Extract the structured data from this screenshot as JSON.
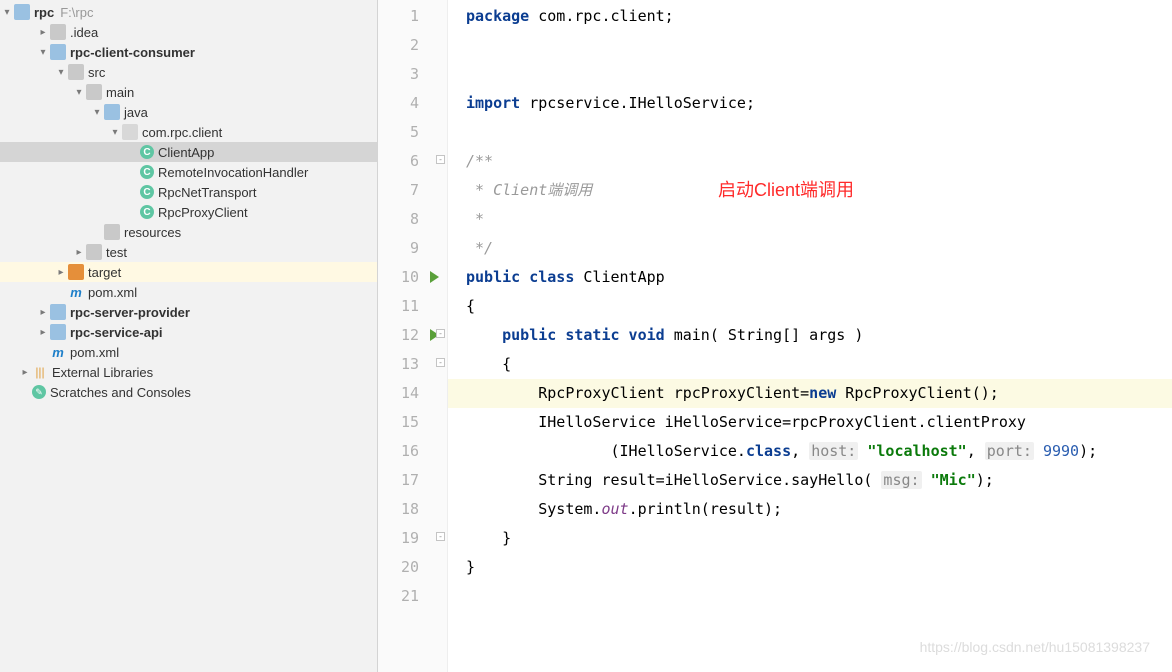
{
  "project": {
    "root_name": "rpc",
    "root_path": "F:\\rpc",
    "nodes": [
      {
        "id": "idea",
        "label": ".idea",
        "depth": 1,
        "icon": "folder",
        "arrow": "right"
      },
      {
        "id": "client-consumer",
        "label": "rpc-client-consumer",
        "depth": 1,
        "icon": "folder-blue",
        "arrow": "down",
        "bold": true
      },
      {
        "id": "src",
        "label": "src",
        "depth": 2,
        "icon": "folder",
        "arrow": "down"
      },
      {
        "id": "main",
        "label": "main",
        "depth": 3,
        "icon": "folder",
        "arrow": "down"
      },
      {
        "id": "java",
        "label": "java",
        "depth": 4,
        "icon": "folder-blue",
        "arrow": "down"
      },
      {
        "id": "pkg",
        "label": "com.rpc.client",
        "depth": 5,
        "icon": "pkg",
        "arrow": "down"
      },
      {
        "id": "clientapp",
        "label": "ClientApp",
        "depth": 6,
        "icon": "class",
        "selected": true
      },
      {
        "id": "remoteinv",
        "label": "RemoteInvocationHandler",
        "depth": 6,
        "icon": "class"
      },
      {
        "id": "rpcnet",
        "label": "RpcNetTransport",
        "depth": 6,
        "icon": "class"
      },
      {
        "id": "rpcproxy",
        "label": "RpcProxyClient",
        "depth": 6,
        "icon": "class"
      },
      {
        "id": "resources",
        "label": "resources",
        "depth": 4,
        "icon": "folder"
      },
      {
        "id": "test",
        "label": "test",
        "depth": 3,
        "icon": "folder",
        "arrow": "right"
      },
      {
        "id": "target",
        "label": "target",
        "depth": 2,
        "icon": "folder-orange",
        "arrow": "right",
        "hl": true
      },
      {
        "id": "pom1",
        "label": "pom.xml",
        "depth": 2,
        "icon": "maven"
      },
      {
        "id": "server-provider",
        "label": "rpc-server-provider",
        "depth": 1,
        "icon": "folder-blue",
        "arrow": "right",
        "bold": true
      },
      {
        "id": "service-api",
        "label": "rpc-service-api",
        "depth": 1,
        "icon": "folder-blue",
        "arrow": "right",
        "bold": true
      },
      {
        "id": "pom2",
        "label": "pom.xml",
        "depth": 1,
        "icon": "maven"
      },
      {
        "id": "extlib",
        "label": "External Libraries",
        "depth": 0,
        "icon": "lib",
        "arrow": "right"
      },
      {
        "id": "scratch",
        "label": "Scratches and Consoles",
        "depth": 0,
        "icon": "scratch"
      }
    ]
  },
  "editor": {
    "annotation": "启动Client端调用",
    "watermark": "https://blog.csdn.net/hu15081398237",
    "highlighted_line": 14,
    "runnable_lines": [
      10,
      12
    ],
    "fold_lines": [
      6,
      12,
      13,
      19
    ],
    "code": {
      "l1": {
        "tokens": [
          {
            "t": "package",
            "c": "kw"
          },
          {
            "t": " com.rpc.client;"
          }
        ]
      },
      "l4": {
        "tokens": [
          {
            "t": "import",
            "c": "kw"
          },
          {
            "t": " rpcservice.IHelloService;"
          }
        ]
      },
      "l6": {
        "tokens": [
          {
            "t": "/**",
            "c": "com"
          }
        ]
      },
      "l7": {
        "tokens": [
          {
            "t": " * Client端调用",
            "c": "com"
          }
        ]
      },
      "l8": {
        "tokens": [
          {
            "t": " *",
            "c": "com"
          }
        ]
      },
      "l9": {
        "tokens": [
          {
            "t": " */",
            "c": "com"
          }
        ]
      },
      "l10": {
        "tokens": [
          {
            "t": "public class",
            "c": "kw"
          },
          {
            "t": " ClientApp"
          }
        ]
      },
      "l11": {
        "tokens": [
          {
            "t": "{"
          }
        ]
      },
      "l12": {
        "tokens": [
          {
            "t": "    "
          },
          {
            "t": "public static void",
            "c": "kw"
          },
          {
            "t": " main( String[] args )"
          }
        ]
      },
      "l13": {
        "tokens": [
          {
            "t": "    {"
          }
        ]
      },
      "l14": {
        "tokens": [
          {
            "t": "        RpcProxyClient rpcProxyClient="
          },
          {
            "t": "new",
            "c": "kw"
          },
          {
            "t": " RpcProxyClient();"
          }
        ]
      },
      "l15": {
        "tokens": [
          {
            "t": "        IHelloService iHelloService=rpcProxyClient.clientProxy"
          }
        ]
      },
      "l16": {
        "tokens": [
          {
            "t": "                (IHelloService."
          },
          {
            "t": "class",
            "c": "kw"
          },
          {
            "t": ", "
          },
          {
            "t": "host:",
            "c": "hint"
          },
          {
            "t": " "
          },
          {
            "t": "\"localhost\"",
            "c": "str"
          },
          {
            "t": ", "
          },
          {
            "t": "port:",
            "c": "hint"
          },
          {
            "t": " "
          },
          {
            "t": "9990",
            "c": "num"
          },
          {
            "t": ");"
          }
        ]
      },
      "l17": {
        "tokens": [
          {
            "t": "        String result=iHelloService.sayHello( "
          },
          {
            "t": "msg:",
            "c": "hint"
          },
          {
            "t": " "
          },
          {
            "t": "\"Mic\"",
            "c": "str"
          },
          {
            "t": ");"
          }
        ]
      },
      "l18": {
        "tokens": [
          {
            "t": "        System."
          },
          {
            "t": "out",
            "c": "field"
          },
          {
            "t": ".println(result);"
          }
        ]
      },
      "l19": {
        "tokens": [
          {
            "t": "    }"
          }
        ]
      },
      "l20": {
        "tokens": [
          {
            "t": "}"
          }
        ]
      }
    }
  }
}
